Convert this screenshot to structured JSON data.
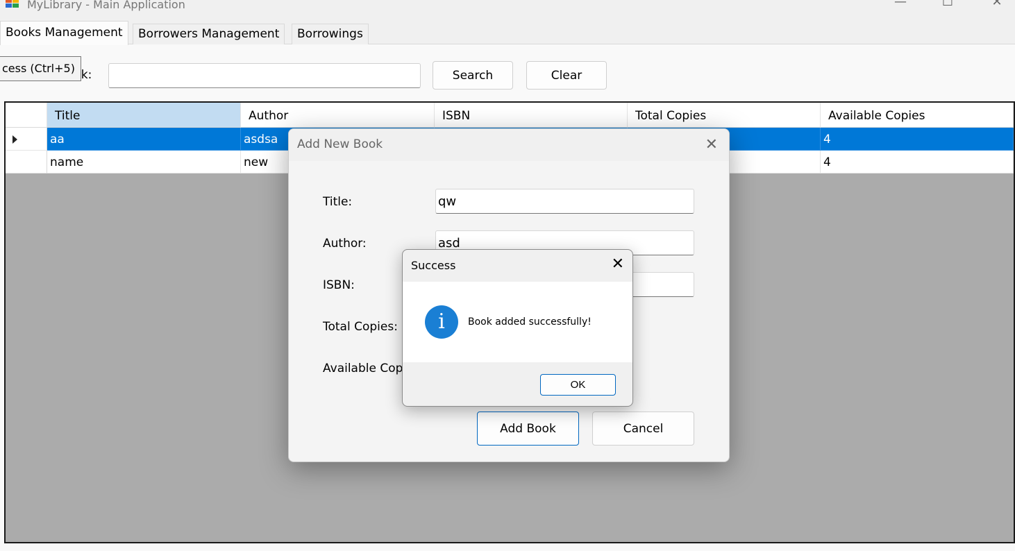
{
  "window": {
    "title": "MyLibrary - Main Application",
    "minimize_glyph": "—",
    "maximize_glyph": "☐",
    "close_glyph": "✕"
  },
  "tabs": [
    {
      "label": "Books Management",
      "active": true
    },
    {
      "label": "Borrowers Management",
      "active": false
    },
    {
      "label": "Borrowings",
      "active": false
    }
  ],
  "books_tab": {
    "search_label": "ook:",
    "search_value": "",
    "search_button": "Search",
    "clear_button": "Clear",
    "tooltip": "cess (Ctrl+5)"
  },
  "grid": {
    "columns": [
      "Title",
      "Author",
      "ISBN",
      "Total Copies",
      "Available Copies"
    ],
    "rows": [
      {
        "title": "aa",
        "author": "asdsa",
        "isbn": "",
        "total": "",
        "available": "4",
        "selected": true
      },
      {
        "title": "name",
        "author": "new",
        "isbn": "",
        "total": "",
        "available": "4",
        "selected": false
      }
    ]
  },
  "add_dialog": {
    "title": "Add New Book",
    "close_glyph": "✕",
    "fields": {
      "title_label": "Title:",
      "title_value": "qw",
      "author_label": "Author:",
      "author_value": "asd",
      "isbn_label": "ISBN:",
      "isbn_value": "",
      "total_label": "Total Copies:",
      "available_label": "Available Cop"
    },
    "add_button": "Add Book",
    "cancel_button": "Cancel"
  },
  "message_box": {
    "title": "Success",
    "close_glyph": "✕",
    "icon": "info-icon",
    "icon_glyph": "i",
    "message": "Book added successfully!",
    "ok_button": "OK"
  },
  "colors": {
    "selection": "#0078d7",
    "header_selected": "#c2dcf2",
    "info_icon": "#1a7fd4",
    "grid_background": "#ababab"
  }
}
